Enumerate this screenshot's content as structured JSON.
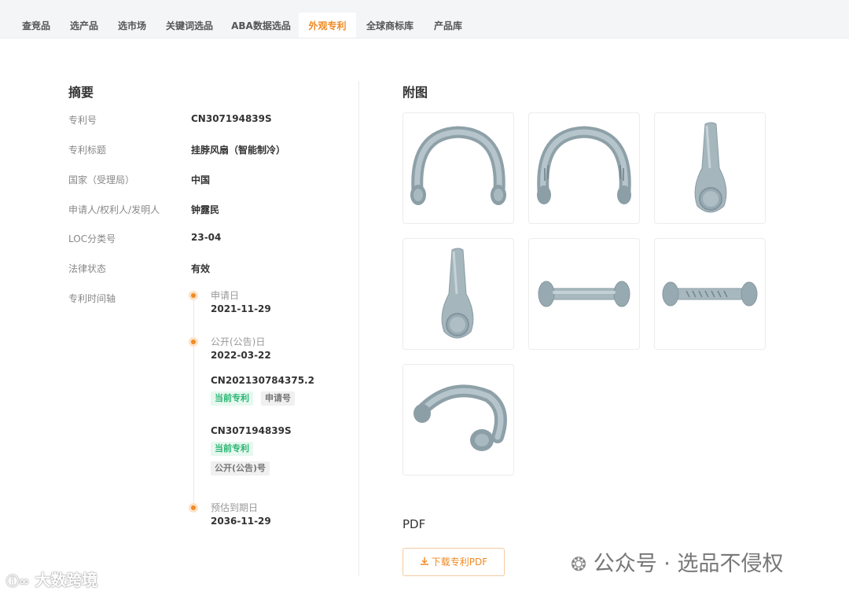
{
  "nav": {
    "tabs": [
      {
        "label": "查竞品"
      },
      {
        "label": "选产品"
      },
      {
        "label": "选市场"
      },
      {
        "label": "关键词选品"
      },
      {
        "label": "ABA数据选品"
      },
      {
        "label": "外观专利"
      },
      {
        "label": "全球商标库"
      },
      {
        "label": "产品库"
      }
    ],
    "active_tab": "外观专利",
    "accent_color": "#f08a24"
  },
  "summary": {
    "title": "摘要",
    "fields": [
      {
        "label": "专利号",
        "value": "CN307194839S"
      },
      {
        "label": "专利标题",
        "value": "挂脖风扇（智能制冷）"
      },
      {
        "label": "国家（受理局）",
        "value": "中国"
      },
      {
        "label": "申请人/权利人/发明人",
        "value": "钟露民"
      },
      {
        "label": "LOC分类号",
        "value": "23-04"
      },
      {
        "label": "法律状态",
        "value": "有效"
      }
    ],
    "timeline_label": "专利时间轴",
    "timeline": {
      "application": {
        "label": "申请日",
        "date": "2021-11-29"
      },
      "publication": {
        "label": "公开(公告)日",
        "date": "2022-03-22"
      },
      "entries": [
        {
          "code": "CN202130784375.2",
          "tags": [
            "当前专利",
            "申请号"
          ]
        },
        {
          "code": "CN307194839S",
          "tags": [
            "当前专利",
            "公开(公告)号"
          ]
        }
      ],
      "expiry": {
        "label": "预估到期日",
        "date": "2036-11-29"
      }
    }
  },
  "figures": {
    "title": "附图",
    "images": [
      {
        "icon": "neck-fan-front-view-icon"
      },
      {
        "icon": "neck-fan-back-view-icon"
      },
      {
        "icon": "neck-fan-side-view-icon"
      },
      {
        "icon": "neck-fan-side-view-icon"
      },
      {
        "icon": "neck-fan-top-view-icon"
      },
      {
        "icon": "neck-fan-bottom-view-icon"
      },
      {
        "icon": "neck-fan-perspective-view-icon"
      }
    ]
  },
  "pdf": {
    "title": "PDF",
    "download_label": "下载专利PDF",
    "download_icon": "download-icon"
  },
  "watermarks": {
    "left": "大数跨境",
    "right": "公众号 · 选品不侵权"
  }
}
